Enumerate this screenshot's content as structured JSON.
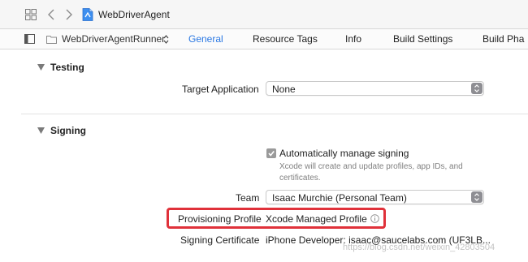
{
  "navigation": {
    "project_title": "WebDriverAgent"
  },
  "tab_bar": {
    "target_name": "WebDriverAgentRunner",
    "tabs": [
      {
        "label": "General",
        "active": true
      },
      {
        "label": "Resource Tags",
        "active": false
      },
      {
        "label": "Info",
        "active": false
      },
      {
        "label": "Build Settings",
        "active": false
      },
      {
        "label": "Build Pha",
        "active": false
      }
    ]
  },
  "testing": {
    "section_title": "Testing",
    "target_application_label": "Target Application",
    "target_application_value": "None"
  },
  "signing": {
    "section_title": "Signing",
    "auto_manage_label": "Automatically manage signing",
    "auto_manage_checked": true,
    "auto_manage_help": "Xcode will create and update profiles, app IDs, and certificates.",
    "team_label": "Team",
    "team_value": "Isaac Murchie (Personal Team)",
    "provisioning_profile_label": "Provisioning Profile",
    "provisioning_profile_value": "Xcode Managed Profile",
    "signing_certificate_label": "Signing Certificate",
    "signing_certificate_value": "iPhone Developer: isaac@saucelabs.com (UF3LB..."
  },
  "watermark": "https://blog.csdn.net/weixin_42803504",
  "colors": {
    "accent": "#2a78e3",
    "highlight": "#e0313a"
  }
}
